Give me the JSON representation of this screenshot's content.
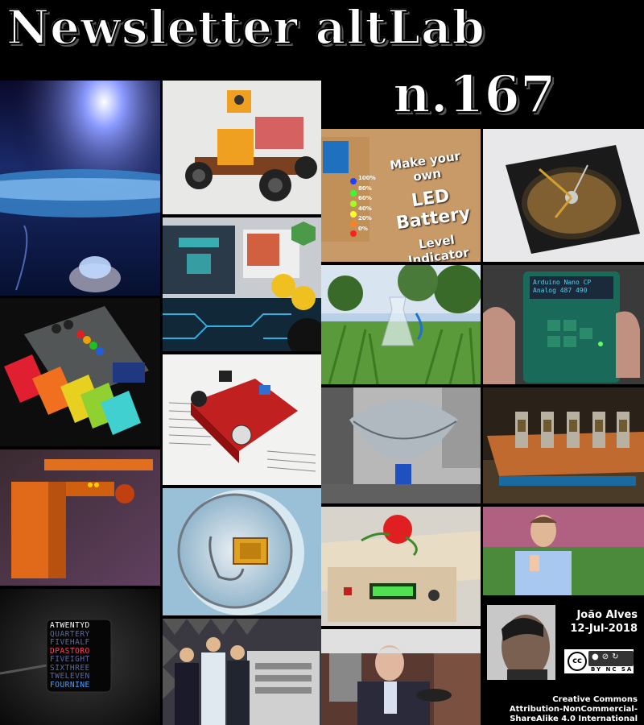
{
  "header": {
    "title": "Newsletter altLab",
    "issue": "n.167"
  },
  "tiles": {
    "battery_tile_text": [
      "Make your own",
      "LED Battery",
      "Level Indicator"
    ],
    "battery_levels": [
      "100%",
      "80%",
      "60%",
      "40%",
      "20%",
      "0%"
    ],
    "lcd_line1": "Arduino Nano CP",
    "lcd_line2": "Analog 487 490",
    "word_clock_rows": [
      "ATWENTYD",
      "QUARTERY",
      "FIVEHALF",
      "DPASTORO",
      "FIVEIGHT",
      "SIXTHREE",
      "TWELEVEN",
      "FOURNINE"
    ]
  },
  "author": {
    "name": "João Alves",
    "date": "12-Jul-2018"
  },
  "license": {
    "badge_cc": "cc",
    "badge_terms": "BY NC SA",
    "lines": [
      "Creative Commons",
      "Attribution-NonCommercial-",
      "ShareAlike 4.0 International"
    ]
  },
  "colors": {
    "background": "#000000",
    "title_text": "#ffffff"
  }
}
